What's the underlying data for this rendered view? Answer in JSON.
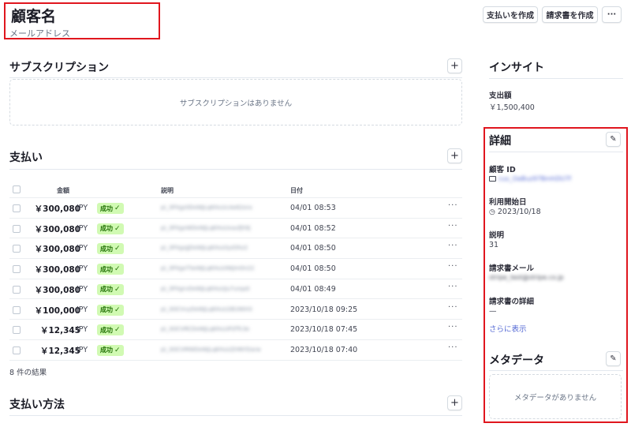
{
  "header": {
    "customer_name": "顧客名",
    "email": "メールアドレス",
    "create_payment_label": "支払いを作成",
    "create_invoice_label": "請求書を作成",
    "more_label": "···"
  },
  "subscriptions": {
    "title": "サブスクリプション",
    "add_label": "+",
    "empty_text": "サブスクリプションはありません"
  },
  "payments": {
    "title": "支払い",
    "add_label": "+",
    "columns": {
      "amount": "金額",
      "description": "説明",
      "date": "日付"
    },
    "rows": [
      {
        "amount": "￥300,080",
        "currency": "JPY",
        "status": "成功",
        "description": "pi_3PXgz0DeWJLqKHuUcAe62ora",
        "date": "04/01 08:53"
      },
      {
        "amount": "￥300,080",
        "currency": "JPY",
        "status": "成功",
        "description": "pi_3PXgxWDeWJLqKHuUxaufJh9j",
        "date": "04/01 08:52"
      },
      {
        "amount": "￥300,080",
        "currency": "JPY",
        "status": "成功",
        "description": "pi_3PXgxJJDeWJLqKHuUlyd3hz2",
        "date": "04/01 08:50"
      },
      {
        "amount": "￥300,080",
        "currency": "JPY",
        "status": "成功",
        "description": "pi_3PXgxTSeWJLqKHuUIWJmOn22",
        "date": "04/01 08:50"
      },
      {
        "amount": "￥300,080",
        "currency": "JPY",
        "status": "成功",
        "description": "pi_3PXgrvDeWJLqKHuUJu7urqa0",
        "date": "04/01 08:49"
      },
      {
        "amount": "￥100,000",
        "currency": "JPY",
        "status": "成功",
        "description": "pi_3OCVvyDeWJLqKHuU2B1NtH3",
        "date": "2023/10/18 09:25"
      },
      {
        "amount": "￥12,345",
        "currency": "JPY",
        "status": "成功",
        "description": "pi_3OCVRCDeWJLqKHuUP2fTc3e",
        "date": "2023/10/18 07:45"
      },
      {
        "amount": "￥12,345",
        "currency": "JPY",
        "status": "成功",
        "description": "pi_3OCVMWDeWJLqKHuUZHNYDarw",
        "date": "2023/10/18 07:40"
      }
    ],
    "result_count": "8 件の結果"
  },
  "payment_methods": {
    "title": "支払い方法",
    "add_label": "+"
  },
  "insights": {
    "title": "インサイト",
    "spend_label": "支出額",
    "spend_value": "￥1,500,400"
  },
  "details": {
    "title": "詳細",
    "customer_id_label": "顧客 ID",
    "customer_id_value": "cus_OaBuz97BmhDU7f",
    "since_label": "利用開始日",
    "since_value": "2023/10/18",
    "description_label": "説明",
    "description_value": "31",
    "invoice_email_label": "請求書メール",
    "invoice_email_value": "stripe_test@stripe.co.jp",
    "invoice_details_label": "請求書の詳細",
    "invoice_details_value": "—",
    "show_more_label": "さらに表示"
  },
  "metadata": {
    "title": "メタデータ",
    "empty_text": "メタデータがありません"
  },
  "colors": {
    "highlight_border": "#e0161e",
    "success_bg": "#d1fab3",
    "success_text": "#217005",
    "link": "#5469d4"
  }
}
